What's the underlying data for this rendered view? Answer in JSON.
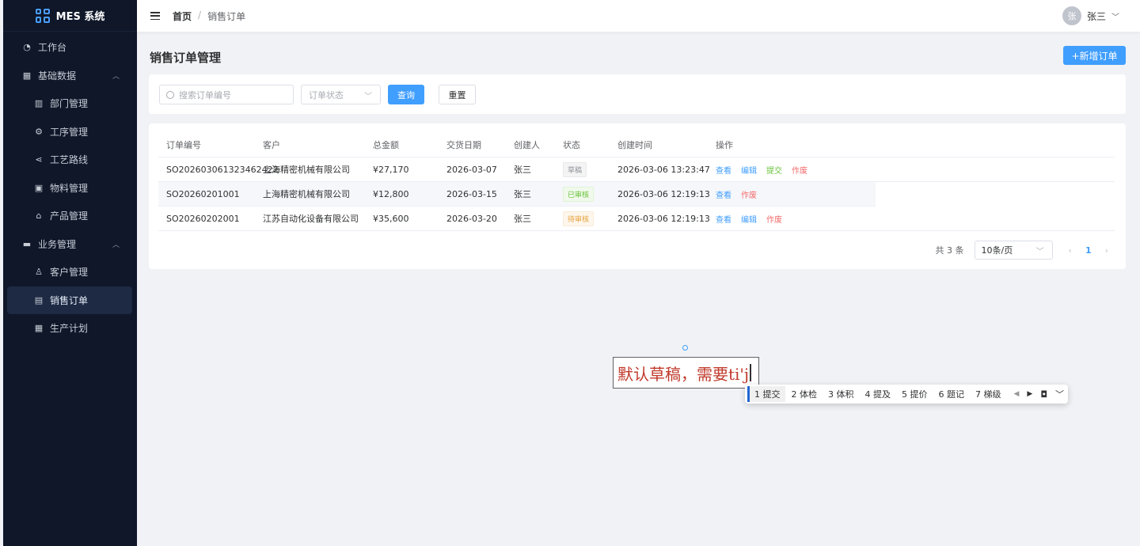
{
  "app": {
    "logo_text": "MES 系统"
  },
  "sidebar": {
    "items": [
      {
        "label": "工作台",
        "icon": "dashboard-icon"
      },
      {
        "label": "基础数据",
        "icon": "grid-icon",
        "expanded": true
      },
      {
        "label": "部门管理",
        "icon": "building-icon"
      },
      {
        "label": "工序管理",
        "icon": "gear-icon"
      },
      {
        "label": "工艺路线",
        "icon": "share-icon"
      },
      {
        "label": "物料管理",
        "icon": "box-icon"
      },
      {
        "label": "产品管理",
        "icon": "bag-icon"
      },
      {
        "label": "业务管理",
        "icon": "briefcase-icon",
        "expanded": true
      },
      {
        "label": "客户管理",
        "icon": "user-icon"
      },
      {
        "label": "销售订单",
        "icon": "document-icon",
        "active": true
      },
      {
        "label": "生产计划",
        "icon": "calendar-icon"
      }
    ]
  },
  "header": {
    "breadcrumb": {
      "home": "首页",
      "separator": "/",
      "current": "销售订单"
    },
    "user": {
      "avatar_text": "张",
      "name": "张三"
    }
  },
  "page": {
    "title": "销售订单管理",
    "add_button": "+新增订单"
  },
  "filter": {
    "search_placeholder": "搜索订单编号",
    "status_placeholder": "订单状态",
    "query_button": "查询",
    "reset_button": "重置"
  },
  "table": {
    "columns": [
      "订单编号",
      "客户",
      "总金额",
      "交货日期",
      "创建人",
      "状态",
      "创建时间",
      "操作"
    ],
    "rows": [
      {
        "order_no": "SO202603061323462422",
        "customer": "上海精密机械有限公司",
        "amount": "¥27,170",
        "delivery": "2026-03-07",
        "creator": "张三",
        "status": "草稿",
        "created": "2026-03-06 13:23:47",
        "actions": [
          "查看",
          "编辑",
          "提交",
          "作废"
        ]
      },
      {
        "order_no": "SO20260201001",
        "customer": "上海精密机械有限公司",
        "amount": "¥12,800",
        "delivery": "2026-03-15",
        "creator": "张三",
        "status": "已审核",
        "created": "2026-03-06 12:19:13",
        "actions": [
          "查看",
          "作废"
        ]
      },
      {
        "order_no": "SO20260202001",
        "customer": "江苏自动化设备有限公司",
        "amount": "¥35,600",
        "delivery": "2026-03-20",
        "creator": "张三",
        "status": "待审核",
        "created": "2026-03-06 12:19:13",
        "actions": [
          "查看",
          "编辑",
          "作废"
        ]
      }
    ]
  },
  "pagination": {
    "total": "共 3 条",
    "page_size": "10条/页",
    "current_page": "1"
  },
  "ime": {
    "composition": "默认草稿，需要ti'j",
    "candidates": [
      "1 提交",
      "2 体检",
      "3 体积",
      "4 提及",
      "5 提价",
      "6 题记",
      "7 梯级"
    ]
  },
  "colors": {
    "primary": "#409eff",
    "sidebar_bg": "#0f1729",
    "success": "#67c23a",
    "danger": "#f56c6c",
    "warning": "#e6a23c"
  }
}
